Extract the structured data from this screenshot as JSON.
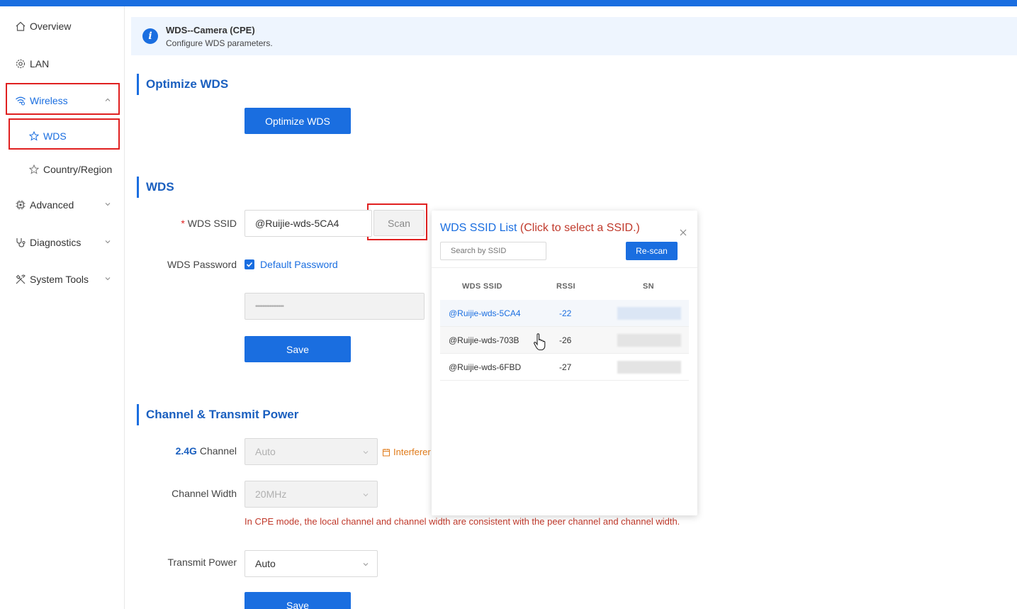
{
  "sidebar": {
    "items": [
      {
        "label": "Overview",
        "icon": "home-icon"
      },
      {
        "label": "LAN",
        "icon": "gear-icon"
      },
      {
        "label": "Wireless",
        "icon": "wifi-icon"
      },
      {
        "label": "WDS",
        "icon": "star-icon"
      },
      {
        "label": "Country/Region",
        "icon": "star-icon"
      },
      {
        "label": "Advanced",
        "icon": "chip-icon"
      },
      {
        "label": "Diagnostics",
        "icon": "stethoscope-icon"
      },
      {
        "label": "System Tools",
        "icon": "tools-icon"
      }
    ]
  },
  "banner": {
    "title": "WDS--Camera (CPE)",
    "description": "Configure WDS parameters."
  },
  "optimize": {
    "title": "Optimize WDS",
    "button": "Optimize WDS"
  },
  "wds": {
    "title": "WDS",
    "ssid_required": "*",
    "ssid_label": "WDS SSID",
    "ssid_value": "@Ruijie-wds-5CA4",
    "scan_button": "Scan",
    "password_label": "WDS Password",
    "default_password_label": "Default Password",
    "default_password_checked": true,
    "password_value": "••••••••••••••••",
    "save_button": "Save"
  },
  "channel": {
    "title": "Channel & Transmit Power",
    "band_label_strong": "2.4G",
    "band_label_rest": " Channel",
    "channel_value": "Auto",
    "interference_label": "Interferer",
    "width_label": "Channel Width",
    "width_value": "20MHz",
    "hint": "In CPE mode, the local channel and channel width are consistent with the peer channel and channel width.",
    "power_label": "Transmit Power",
    "power_value": "Auto",
    "save_button": "Save"
  },
  "popup": {
    "title_main": "WDS SSID List",
    "title_hint": " (Click to select a SSID.)",
    "search_placeholder": "Search by SSID",
    "rescan_button": "Re-scan",
    "columns": [
      "WDS SSID",
      "RSSI",
      "SN"
    ],
    "rows": [
      {
        "ssid": "@Ruijie-wds-5CA4",
        "rssi": "-22"
      },
      {
        "ssid": "@Ruijie-wds-703B",
        "rssi": "-26"
      },
      {
        "ssid": "@Ruijie-wds-6FBD",
        "rssi": "-27"
      }
    ]
  },
  "colors": {
    "accent": "#1a6ee0",
    "highlight_box": "#e02020",
    "warning": "#c0392b"
  }
}
